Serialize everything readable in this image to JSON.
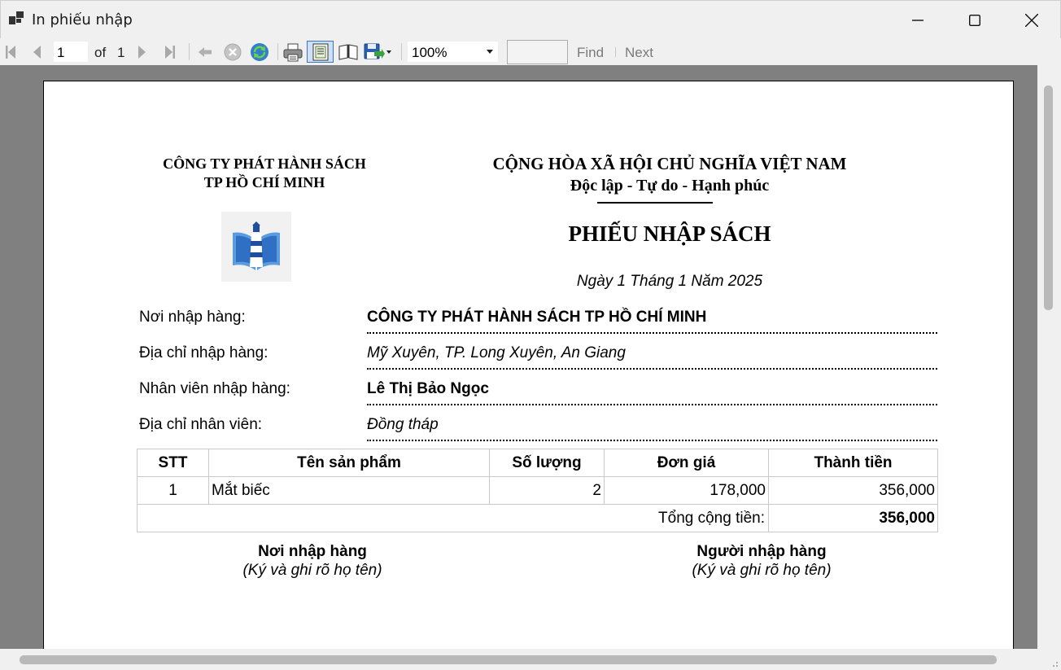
{
  "window": {
    "title": "In phiếu nhập"
  },
  "toolbar": {
    "current_page": "1",
    "of_label": "of",
    "total_pages": "1",
    "zoom": "100%",
    "find_label": "Find",
    "next_label": "Next",
    "icons": [
      "first-page-icon",
      "previous-page-icon",
      "next-page-icon",
      "last-page-icon",
      "back-icon",
      "stop-icon",
      "refresh-icon",
      "print-icon",
      "print-layout-icon",
      "page-setup-icon",
      "export-icon"
    ]
  },
  "report": {
    "company_line1": "CÔNG TY PHÁT HÀNH SÁCH",
    "company_line2": "TP HỒ CHÍ MINH",
    "nation_line1": "CỘNG HÒA XÃ HỘI CHỦ NGHĨA VIỆT NAM",
    "nation_line2": "Độc lập - Tự do - Hạnh phúc",
    "title": "PHIẾU NHẬP SÁCH",
    "date": "Ngày 1 Tháng 1 Năm 2025",
    "fields": [
      {
        "label": "Nơi nhập hàng:",
        "value": "CÔNG TY PHÁT HÀNH SÁCH TP HỒ CHÍ MINH"
      },
      {
        "label": "Địa chỉ nhập hàng:",
        "value": "Mỹ Xuyên, TP. Long Xuyên, An Giang"
      },
      {
        "label": "Nhân viên nhập hàng:",
        "value": "Lê Thị Bảo Ngọc"
      },
      {
        "label": "Địa chỉ nhân viên:",
        "value": "Đồng tháp"
      }
    ],
    "table": {
      "headers": [
        "STT",
        "Tên sản phẩm",
        "Số lượng",
        "Đơn giá",
        "Thành tiền"
      ],
      "rows": [
        [
          "1",
          "Mắt biếc",
          "2",
          "178,000",
          "356,000"
        ]
      ],
      "total_label": "Tổng cộng tiền:",
      "total_value": "356,000"
    },
    "signatures": [
      {
        "title": "Nơi nhập hàng",
        "note": "(Ký và ghi rõ họ tên)"
      },
      {
        "title": "Người nhập hàng",
        "note": "(Ký và ghi rõ họ tên)"
      }
    ]
  }
}
